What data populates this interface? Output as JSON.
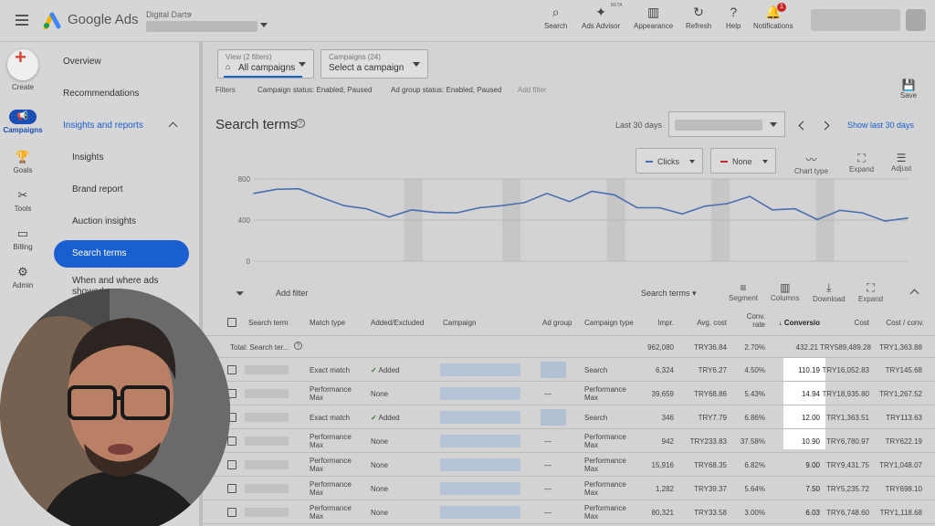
{
  "topbar": {
    "brand": "Google Ads",
    "account_name": "Digital Darts",
    "tools": [
      {
        "label": "Search",
        "icon": "search-icon"
      },
      {
        "label": "Ads Advisor",
        "icon": "sparkle-icon",
        "badge": "BETA"
      },
      {
        "label": "Appearance",
        "icon": "appearance-icon"
      },
      {
        "label": "Refresh",
        "icon": "refresh-icon"
      },
      {
        "label": "Help",
        "icon": "help-icon"
      },
      {
        "label": "Notifications",
        "icon": "bell-icon",
        "count": "1"
      }
    ]
  },
  "rail": {
    "create": "Create",
    "items": [
      {
        "label": "Campaigns",
        "icon": "megaphone-icon",
        "active": true
      },
      {
        "label": "Goals",
        "icon": "trophy-icon"
      },
      {
        "label": "Tools",
        "icon": "tools-icon"
      },
      {
        "label": "Billing",
        "icon": "card-icon"
      },
      {
        "label": "Admin",
        "icon": "gear-icon"
      }
    ]
  },
  "nav": {
    "overview": "Overview",
    "recommendations": "Recommendations",
    "insights_reports": "Insights and reports",
    "insights": "Insights",
    "brand_report": "Brand report",
    "auction_insights": "Auction insights",
    "search_terms": "Search terms",
    "when_where": "When and where ads",
    "when_where_2": "showed"
  },
  "main": {
    "view_small": "View (2 filters)",
    "view_main": "All campaigns",
    "campaigns_small": "Campaigns (24)",
    "campaigns_main": "Select a campaign",
    "filters_label": "Filters",
    "filter_1": "Campaign status: Enabled, Paused",
    "filter_2": "Ad group status: Enabled, Paused",
    "add_filter": "Add filter",
    "save": "Save",
    "title": "Search terms",
    "range_label": "Last 30 days",
    "show_last": "Show last 30 days",
    "metric_1": "Clicks",
    "metric_2": "None",
    "chart_type": "Chart type",
    "expand": "Expand",
    "adjust": "Adjust"
  },
  "chart_data": {
    "type": "line",
    "y_ticks": [
      "800",
      "400",
      "0"
    ],
    "ylim": [
      0,
      800
    ],
    "series": [
      {
        "color": "#4a6fb0",
        "values": [
          660,
          700,
          705,
          620,
          540,
          510,
          430,
          500,
          475,
          470,
          520,
          540,
          570,
          660,
          580,
          680,
          645,
          520,
          520,
          460,
          535,
          560,
          630,
          500,
          510,
          405,
          495,
          470,
          390,
          420
        ]
      }
    ]
  },
  "table": {
    "add_filter": "Add filter",
    "search_terms_dropdown": "Search terms",
    "segment": "Segment",
    "columns_label": "Columns",
    "download": "Download",
    "expand": "Expand",
    "headers": {
      "term": "Search term",
      "match": "Match type",
      "added": "Added/Excluded",
      "campaign": "Campaign",
      "adgroup": "Ad group",
      "ctype": "Campaign type",
      "impr": "Impr.",
      "avgcost": "Avg. cost",
      "convrate": "Conv. rate",
      "conv": "Conversio",
      "cost": "Cost",
      "costconv": "Cost / conv."
    },
    "total": {
      "label": "Total: Search ter...",
      "impr": "962,080",
      "avgcost": "TRY36.84",
      "convrate": "2.70%",
      "conv": "432.21",
      "cost": "TRY589,489.28",
      "costconv": "TRY1,363.88"
    },
    "rows": [
      {
        "match": "Exact match",
        "match2": "",
        "added": "Added",
        "ag": "blur",
        "ctype": "Search",
        "ctype2": "",
        "impr": "6,324",
        "avgcost": "TRY6.27",
        "convrate": "4.50%",
        "conv": "110.19",
        "cost": "TRY16,052.83",
        "costconv": "TRY145.68"
      },
      {
        "match": "Performance",
        "match2": "Max",
        "added": "None",
        "ag": "—",
        "ctype": "Performance",
        "ctype2": "Max",
        "impr": "39,659",
        "avgcost": "TRY68.86",
        "convrate": "5.43%",
        "conv": "14.94",
        "cost": "TRY18,935.80",
        "costconv": "TRY1,267.52"
      },
      {
        "match": "Exact match",
        "match2": "",
        "added": "Added",
        "ag": "blur",
        "ctype": "Search",
        "ctype2": "",
        "impr": "346",
        "avgcost": "TRY7.79",
        "convrate": "6.86%",
        "conv": "12.00",
        "cost": "TRY1,363.51",
        "costconv": "TRY113.63"
      },
      {
        "match": "Performance",
        "match2": "Max",
        "added": "None",
        "ag": "—",
        "ctype": "Performance",
        "ctype2": "Max",
        "impr": "942",
        "avgcost": "TRY233.83",
        "convrate": "37.58%",
        "conv": "10.90",
        "cost": "TRY6,780.97",
        "costconv": "TRY622.19"
      },
      {
        "match": "Performance",
        "match2": "Max",
        "added": "None",
        "ag": "—",
        "ctype": "Performance",
        "ctype2": "Max",
        "impr": "15,916",
        "avgcost": "TRY68.35",
        "convrate": "6.82%",
        "conv": "9.00",
        "cost": "TRY9,431.75",
        "costconv": "TRY1,048.07"
      },
      {
        "match": "Performance",
        "match2": "Max",
        "added": "None",
        "ag": "—",
        "ctype": "Performance",
        "ctype2": "Max",
        "impr": "1,282",
        "avgcost": "TRY39.37",
        "convrate": "5.64%",
        "conv": "7.50",
        "cost": "TRY5,235.72",
        "costconv": "TRY698.10"
      },
      {
        "match": "Performance",
        "match2": "Max",
        "added": "None",
        "ag": "—",
        "ctype": "Performance",
        "ctype2": "Max",
        "impr": "80,321",
        "avgcost": "TRY33.58",
        "convrate": "3.00%",
        "conv": "6.03",
        "cost": "TRY6,748.60",
        "costconv": "TRY1,118.68"
      }
    ]
  }
}
